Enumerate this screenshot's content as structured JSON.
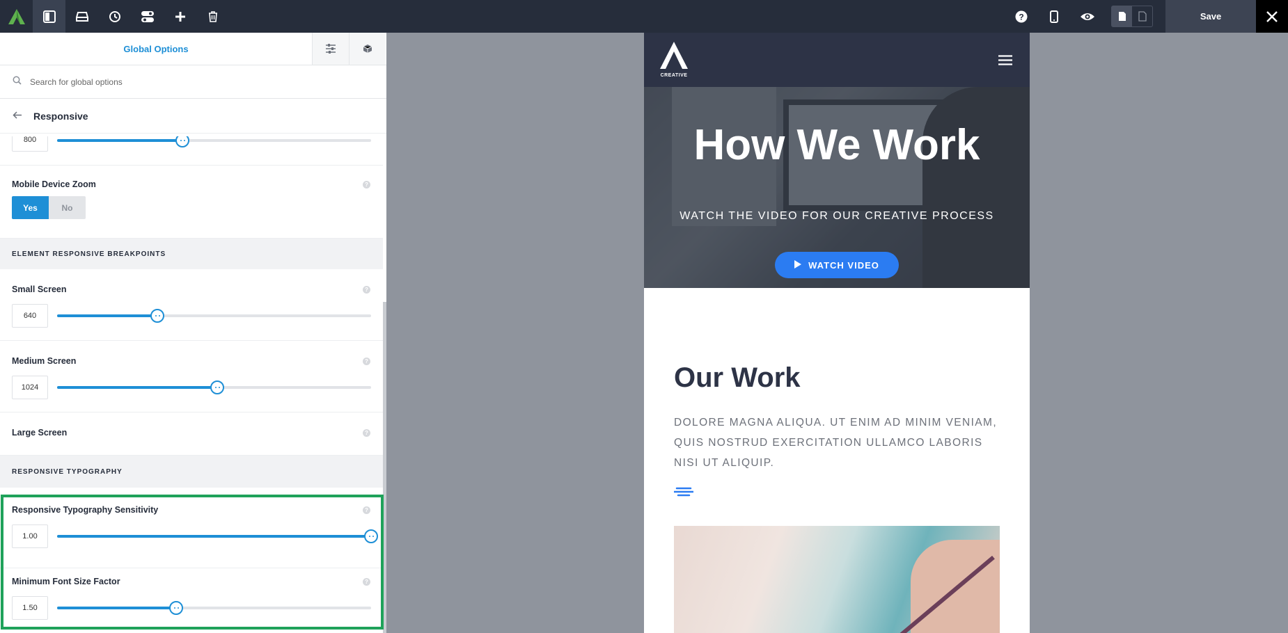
{
  "toolbar": {
    "save_label": "Save",
    "icons": [
      "avada-logo-icon",
      "sidebar-toggle-icon",
      "library-icon",
      "history-icon",
      "toggles-icon",
      "add-icon",
      "trash-icon",
      "help-icon",
      "mobile-icon",
      "preview-eye-icon",
      "page-icon",
      "page-outline-icon",
      "close-icon"
    ]
  },
  "sidebar": {
    "tab_label": "Global Options",
    "search_placeholder": "Search for global options",
    "breadcrumb_title": "Responsive",
    "top_slider": {
      "value": "800",
      "fraction": 0.4
    },
    "mobile_zoom": {
      "label": "Mobile Device Zoom",
      "yes": "Yes",
      "no": "No",
      "selected": "Yes"
    },
    "section_breakpoints": "ELEMENT RESPONSIVE BREAKPOINTS",
    "small_screen": {
      "label": "Small Screen",
      "value": "640",
      "fraction": 0.32
    },
    "medium_screen": {
      "label": "Medium Screen",
      "value": "1024",
      "fraction": 0.51
    },
    "large_screen": {
      "label": "Large Screen"
    },
    "section_typography": "RESPONSIVE TYPOGRAPHY",
    "typo_sensitivity": {
      "label": "Responsive Typography Sensitivity",
      "value": "1.00",
      "fraction": 1.0
    },
    "min_font_factor": {
      "label": "Minimum Font Size Factor",
      "value": "1.50",
      "fraction": 0.38
    },
    "help_glyph": "?"
  },
  "preview": {
    "logo_text": "CREATIVE",
    "hero_title": "How We Work",
    "hero_subtitle": "WATCH THE VIDEO FOR OUR CREATIVE PROCESS",
    "watch_button": "WATCH VIDEO",
    "section_title": "Our Work",
    "section_body": "DOLORE MAGNA ALIQUA. UT ENIM AD MINIM VENIAM, QUIS NOSTRUD EXERCITATION ULLAMCO LABORIS NISI UT ALIQUIP."
  },
  "colors": {
    "accent": "#1e8fd6",
    "highlight": "#1fa25a",
    "topbar": "#262d3b",
    "button_blue": "#2b7cf2"
  }
}
